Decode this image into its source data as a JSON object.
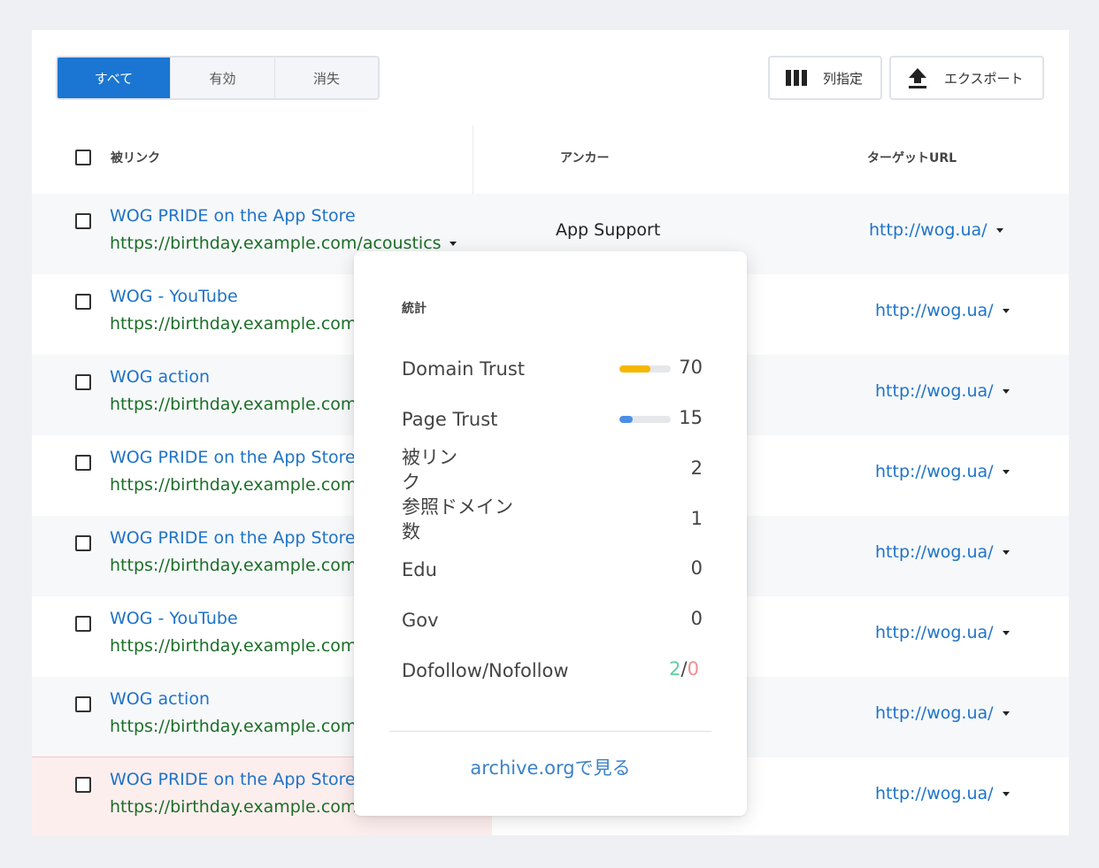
{
  "filter_tabs": [
    {
      "label": "すべて",
      "active": true
    },
    {
      "label": "有効",
      "active": false
    },
    {
      "label": "消失",
      "active": false
    }
  ],
  "toolbar": {
    "columns_label": "列指定",
    "columns_icon": "columns-icon",
    "export_label": "エクスポート",
    "export_icon": "upload-icon"
  },
  "table": {
    "headers": {
      "backlink": "被リンク",
      "anchor": "アンカー",
      "target": "ターゲットURL"
    },
    "rows": [
      {
        "title": "WOG PRIDE on the App Store",
        "url": "https://birthday.example.com/acoustics",
        "anchor": "App Support",
        "target": "http://wog.ua/"
      },
      {
        "title": "WOG - YouTube",
        "url": "https://birthday.example.com/",
        "anchor": "",
        "target": "http://wog.ua/"
      },
      {
        "title": "WOG action",
        "url": "https://birthday.example.com/",
        "anchor": "",
        "target": "http://wog.ua/"
      },
      {
        "title": "WOG PRIDE on the App Store",
        "url": "https://birthday.example.com/",
        "anchor": "",
        "target": "http://wog.ua/"
      },
      {
        "title": "WOG PRIDE on the App Store",
        "url": "https://birthday.example.com/",
        "anchor": "",
        "target": "http://wog.ua/"
      },
      {
        "title": "WOG - YouTube",
        "url": "https://birthday.example.com/",
        "anchor": "",
        "target": "http://wog.ua/"
      },
      {
        "title": "WOG action",
        "url": "https://birthday.example.com/",
        "anchor": "",
        "target": "http://wog.ua/"
      },
      {
        "title": "WOG PRIDE on the App Store",
        "url": "https://birthday.example.com/a",
        "anchor": "",
        "target": "http://wog.ua/"
      }
    ]
  },
  "popup": {
    "title": "統計",
    "stats": [
      {
        "label": "Domain Trust",
        "value": "70",
        "bar_fraction": 0.6,
        "bar_color": "#f5b800"
      },
      {
        "label": "Page Trust",
        "value": "15",
        "bar_fraction": 0.25,
        "bar_color": "#4a8fe6"
      },
      {
        "label": "被リンク",
        "value": "2"
      },
      {
        "label": "参照ドメイン数",
        "value": "1"
      },
      {
        "label": "Edu",
        "value": "0"
      },
      {
        "label": "Gov",
        "value": "0"
      },
      {
        "label": "Dofollow/Nofollow",
        "dofollow": "2",
        "slash": "/",
        "nofollow": "0"
      }
    ],
    "archive_link": "archive.orgで見る",
    "colors": {
      "dofollow": "#5fcfa0",
      "nofollow": "#ef8f8f"
    }
  }
}
